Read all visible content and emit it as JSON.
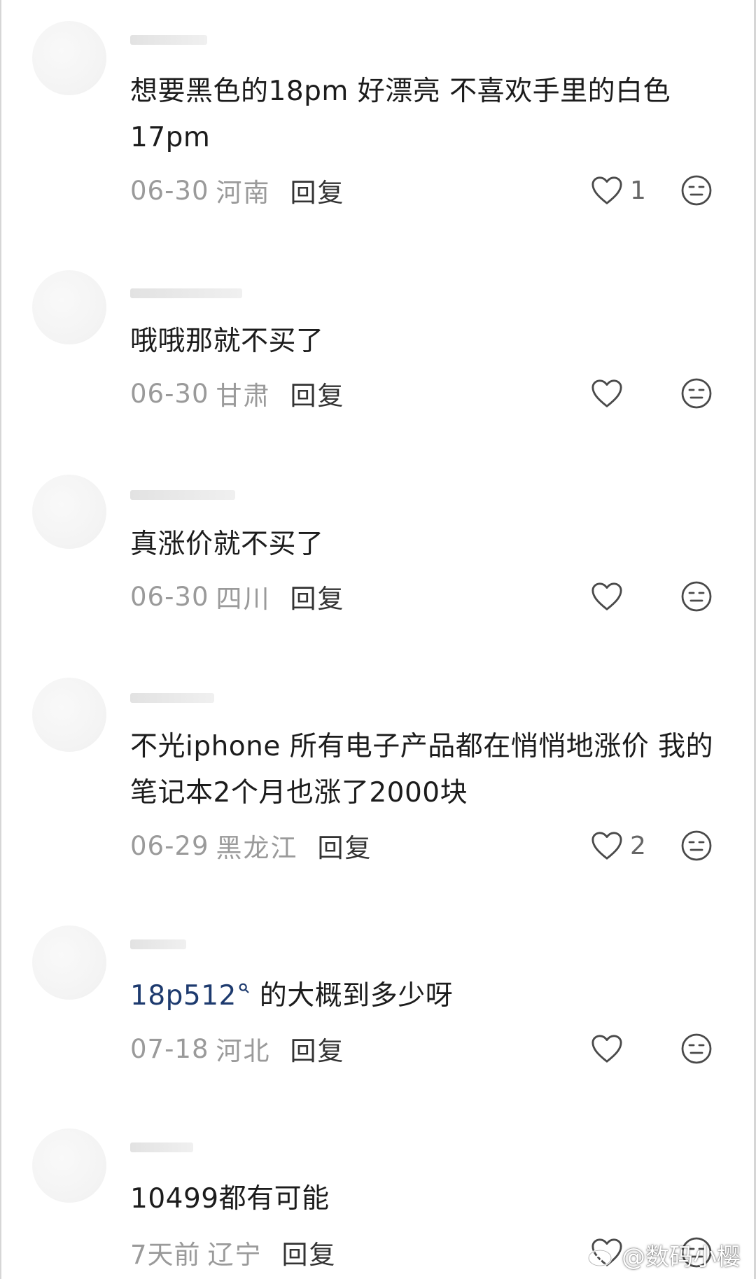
{
  "comments": [
    {
      "text": "想要黑色的18pm 好漂亮 不喜欢手里的白色17pm",
      "date": "06-30",
      "region": "河南",
      "reply_label": "回复",
      "likes": "1"
    },
    {
      "text": "哦哦那就不买了",
      "date": "06-30",
      "region": "甘肃",
      "reply_label": "回复",
      "likes": ""
    },
    {
      "text": "真涨价就不买了",
      "date": "06-30",
      "region": "四川",
      "reply_label": "回复",
      "likes": ""
    },
    {
      "text": "不光iphone 所有电子产品都在悄悄地涨价  我的笔记本2个月也涨了2000块",
      "date": "06-29",
      "region": "黑龙江",
      "reply_label": "回复",
      "likes": "2"
    },
    {
      "mention": "18p512",
      "text": " 的大概到多少呀",
      "date": "07-18",
      "region": "河北",
      "reply_label": "回复",
      "likes": ""
    },
    {
      "text": "10499都有可能",
      "date": "7天前",
      "region": "辽宁",
      "reply_label": "回复",
      "likes": ""
    }
  ],
  "watermark": {
    "text": "@数码小樱",
    "icon": "weibo-logo"
  },
  "icons": {
    "like": "heart-outline-icon",
    "dislike": "meh-face-icon",
    "mention": "search-magnifier-icon"
  },
  "colors": {
    "text": "#1c1c1c",
    "meta": "#9a9a9a",
    "mention": "#1d3a6e"
  }
}
